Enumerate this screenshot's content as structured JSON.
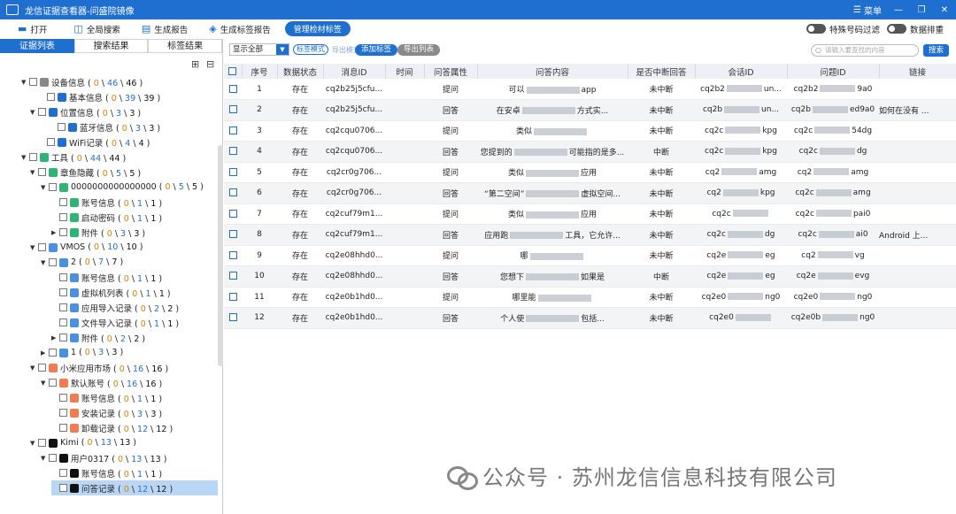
{
  "window": {
    "title": "龙信证据查看器-问盛院镜像",
    "menu_label": "菜单",
    "min": "—",
    "restore": "❐",
    "close": "✕"
  },
  "toolbar": {
    "open": "打开",
    "global_search": "全局搜索",
    "gen_report": "生成报告",
    "gen_tag_report": "生成标签报告",
    "manage_tags": "管理检材标签",
    "special_filter": "特殊号码过滤",
    "data_sort": "数据排重"
  },
  "left_tabs": [
    "证据列表",
    "搜索结果",
    "标签结果"
  ],
  "tree": [
    {
      "label": "设备信息",
      "a": "0",
      "b": "46",
      "c": "46"
    },
    {
      "label": "基本信息",
      "a": "0",
      "b": "39",
      "c": "39"
    },
    {
      "label": "位置信息",
      "a": "0",
      "b": "3",
      "c": "3"
    },
    {
      "label": "蓝牙信息",
      "a": "0",
      "b": "3",
      "c": "3"
    },
    {
      "label": "WiFi记录",
      "a": "0",
      "b": "4",
      "c": "4"
    },
    {
      "label": "工具",
      "a": "0",
      "b": "44",
      "c": "44"
    },
    {
      "label": "章鱼隐藏",
      "a": "0",
      "b": "5",
      "c": "5"
    },
    {
      "label": "0000000000000000",
      "a": "0",
      "b": "5",
      "c": "5"
    },
    {
      "label": "账号信息",
      "a": "0",
      "b": "1",
      "c": "1"
    },
    {
      "label": "启动密码",
      "a": "0",
      "b": "1",
      "c": "1"
    },
    {
      "label": "附件",
      "a": "0",
      "b": "3",
      "c": "3"
    },
    {
      "label": "VMOS",
      "a": "0",
      "b": "10",
      "c": "10"
    },
    {
      "label": "2",
      "a": "0",
      "b": "7",
      "c": "7"
    },
    {
      "label": "账号信息",
      "a": "0",
      "b": "1",
      "c": "1"
    },
    {
      "label": "虚拟机列表",
      "a": "0",
      "b": "1",
      "c": "1"
    },
    {
      "label": "应用导入记录",
      "a": "0",
      "b": "2",
      "c": "2"
    },
    {
      "label": "文件导入记录",
      "a": "0",
      "b": "1",
      "c": "1"
    },
    {
      "label": "附件",
      "a": "0",
      "b": "2",
      "c": "2"
    },
    {
      "label": "1",
      "a": "0",
      "b": "3",
      "c": "3"
    },
    {
      "label": "小米应用市场",
      "a": "0",
      "b": "16",
      "c": "16"
    },
    {
      "label": "默认账号",
      "a": "0",
      "b": "16",
      "c": "16"
    },
    {
      "label": "账号信息",
      "a": "0",
      "b": "1",
      "c": "1"
    },
    {
      "label": "安装记录",
      "a": "0",
      "b": "3",
      "c": "3"
    },
    {
      "label": "卸载记录",
      "a": "0",
      "b": "12",
      "c": "12"
    },
    {
      "label": "Kimi",
      "a": "0",
      "b": "13",
      "c": "13"
    },
    {
      "label": "用户0317",
      "a": "0",
      "b": "13",
      "c": "13"
    },
    {
      "label": "账号信息",
      "a": "0",
      "b": "1",
      "c": "1"
    },
    {
      "label": "问答记录",
      "a": "0",
      "b": "12",
      "c": "12"
    }
  ],
  "filter": {
    "select_value": "显示全部",
    "tag_mode": "标签模式",
    "export_mode": "导出模式",
    "add_tag": "添加标签",
    "export_list": "导出列表",
    "search_placeholder": "请输入要查找的内容",
    "search_btn": "搜索"
  },
  "table": {
    "headers": [
      "序号",
      "数据状态",
      "消息ID",
      "时间",
      "问答属性",
      "问答内容",
      "是否中断回答",
      "会话ID",
      "问题ID",
      "链接"
    ],
    "rows": [
      [
        "1",
        "存在",
        "cq2b25j5cfu...",
        "",
        "提问",
        "可以",
        "app",
        "未中断",
        "cq2b2",
        "un...",
        "cq2b2",
        "9a0",
        ""
      ],
      [
        "2",
        "存在",
        "cq2b25j5cfu...",
        "",
        "回答",
        "在安卓",
        "方式实...",
        "未中断",
        "cq2b",
        "un...",
        "cq2b",
        "ed9a0",
        "如何在没有 ..."
      ],
      [
        "3",
        "存在",
        "cq2cqu0706...",
        "",
        "提问",
        "类似",
        "",
        "未中断",
        "cq2c",
        "kpg",
        "cq2c",
        "54dg",
        ""
      ],
      [
        "4",
        "存在",
        "cq2cqu0706...",
        "",
        "回答",
        "您提到的",
        "可能指的是多...",
        "中断",
        "cq2c",
        "kpg",
        "cq2c",
        "dg",
        ""
      ],
      [
        "5",
        "存在",
        "cq2cr0g706...",
        "",
        "提问",
        "类似",
        "应用",
        "未中断",
        "cq2",
        "amg",
        "cq2",
        "amg",
        ""
      ],
      [
        "6",
        "存在",
        "cq2cr0g706...",
        "",
        "回答",
        "“第二空间”",
        "虚拟空间...",
        "未中断",
        "cq2",
        "kpg",
        "cq2c",
        "amg",
        ""
      ],
      [
        "7",
        "存在",
        "cq2cuf79m1...",
        "",
        "提问",
        "类似",
        "应用",
        "未中断",
        "cq2c",
        "",
        "cq2c",
        "pai0",
        ""
      ],
      [
        "8",
        "存在",
        "cq2cuf79m1...",
        "",
        "回答",
        "应用跑",
        "工具，它允许...",
        "未中断",
        "cq2c",
        "dg",
        "cq2c",
        "ai0",
        "Android 上..."
      ],
      [
        "9",
        "存在",
        "cq2e08hhd0...",
        "",
        "提问",
        "哪",
        "",
        "未中断",
        "cq2e",
        "eg",
        "cq2",
        "vg",
        ""
      ],
      [
        "10",
        "存在",
        "cq2e08hhd0...",
        "",
        "回答",
        "您想下",
        "如果是",
        "中断",
        "cq2e",
        "eg",
        "cq2e",
        "evg",
        ""
      ],
      [
        "11",
        "存在",
        "cq2e0b1hd0...",
        "",
        "提问",
        "哪里能",
        "",
        "未中断",
        "cq2e0",
        "ng0",
        "cq2e0",
        "ng0",
        ""
      ],
      [
        "12",
        "存在",
        "cq2e0b1hd0...",
        "",
        "回答",
        "个人使",
        "包括...",
        "未中断",
        "cq2e0",
        "",
        "cq2e0b",
        "ng0",
        ""
      ]
    ]
  },
  "watermark": "公众号 · 苏州龙信信息科技有限公司",
  "colors": {
    "accent": "#1f6fd1",
    "count_a": "#e08000",
    "count_b": "#1f6fd1"
  }
}
